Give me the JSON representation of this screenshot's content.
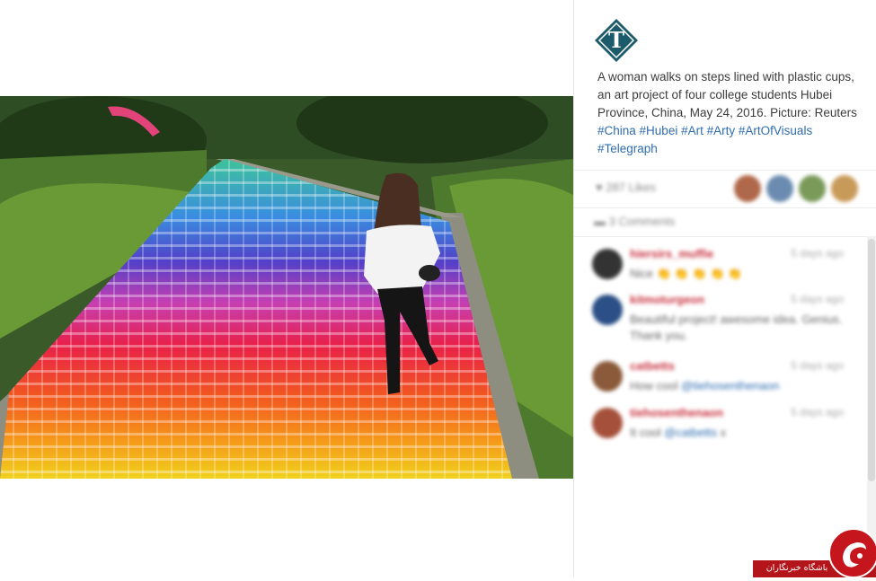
{
  "post": {
    "caption_text": "A woman walks on steps lined with plastic cups, an art project of four college students Hubei Province, China, May 24, 2016. Picture: Reuters",
    "hashtags": [
      "#China",
      "#Hubei",
      "#Art",
      "#Arty",
      "#ArtOfVisuals",
      "#Telegraph"
    ]
  },
  "likes": {
    "text": "287 Likes"
  },
  "comments_header": {
    "text": "3 Comments"
  },
  "comments": [
    {
      "user": "hiersirs_muffie",
      "time": "5 days ago",
      "text": "Nice ",
      "emoji": "👏 👏 👏 👏 👏",
      "mention": "",
      "text_after": ""
    },
    {
      "user": "kitmoturgeon",
      "time": "5 days ago",
      "text": "Beautiful project! awesome idea. Genius. Thank you.",
      "emoji": "",
      "mention": "",
      "text_after": ""
    },
    {
      "user": "catbetts",
      "time": "5 days ago",
      "text": "How cool ",
      "emoji": "",
      "mention": "@tiehosenthenaon",
      "text_after": ""
    },
    {
      "user": "tiehosenthenaon",
      "time": "5 days ago",
      "text": "It cool ",
      "emoji": "",
      "mention": "@catbetts",
      "text_after": " x"
    }
  ],
  "watermark": {
    "text": "باشگاه خبرنگاران"
  },
  "colors": {
    "hashtag": "#2f6db0",
    "username": "#c8323f",
    "logo_bg": "#1b5b6b",
    "watermark_red": "#b3151a"
  },
  "icons": [
    "telegraph-logo-icon",
    "heart-icon",
    "comment-icon",
    "watermark-logo-icon"
  ]
}
